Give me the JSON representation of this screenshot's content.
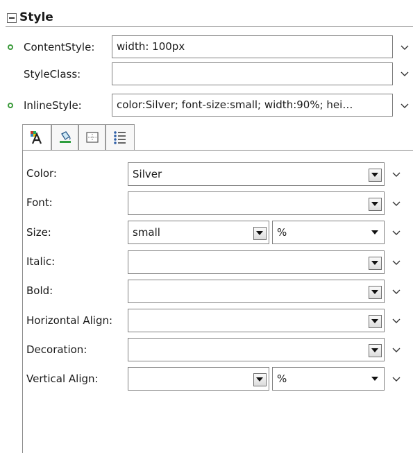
{
  "section": {
    "title": "Style"
  },
  "properties": [
    {
      "label": "ContentStyle:",
      "value": "width: 100px",
      "has_value_marker": true
    },
    {
      "label": "StyleClass:",
      "value": "",
      "has_value_marker": false
    },
    {
      "label": "InlineStyle:",
      "value": "color:Silver; font-size:small; width:90%; hei…",
      "has_value_marker": true
    }
  ],
  "tabs": [
    {
      "icon": "text-style-icon",
      "active": true
    },
    {
      "icon": "paint-bucket-icon",
      "active": false
    },
    {
      "icon": "box-layout-icon",
      "active": false
    },
    {
      "icon": "list-style-icon",
      "active": false
    }
  ],
  "style_rows": [
    {
      "label": "Color:",
      "value": "Silver"
    },
    {
      "label": "Font:",
      "value": ""
    },
    {
      "label": "Size:",
      "value": "small",
      "unit": "%"
    },
    {
      "label": "Italic:",
      "value": ""
    },
    {
      "label": "Bold:",
      "value": ""
    },
    {
      "label": "Horizontal Align:",
      "value": ""
    },
    {
      "label": "Decoration:",
      "value": ""
    },
    {
      "label": "Vertical Align:",
      "value": "",
      "unit": "%"
    }
  ],
  "colors": {
    "value_marker": "#3a9a3a",
    "border": "#7f7f7f"
  }
}
